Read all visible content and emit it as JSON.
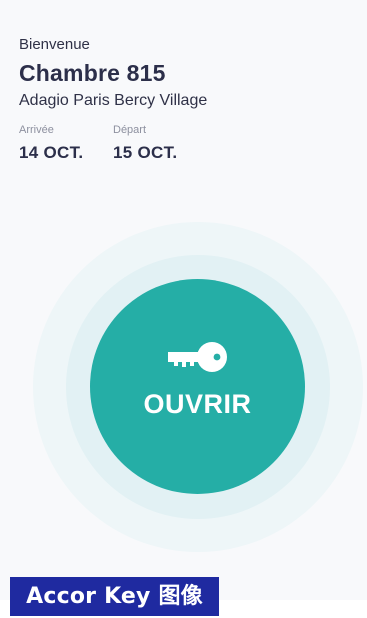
{
  "header": {
    "welcome": "Bienvenue",
    "room": "Chambre 815",
    "hotel": "Adagio Paris Bercy Village"
  },
  "stay": {
    "arrival_label": "Arrivée",
    "arrival_date": "14 OCT.",
    "departure_label": "Départ",
    "departure_date": "15 OCT."
  },
  "action": {
    "open_label": "OUVRIR",
    "icon": "key-icon"
  },
  "watermark": {
    "text": "Accor Key 图像"
  },
  "colors": {
    "accent": "#25aea6",
    "halo_outer": "#eef6f8",
    "halo_mid": "#e2f1f4",
    "text_dark": "#2c2f4a",
    "text_muted": "#8d909f",
    "watermark_bg": "#1f2aa0"
  }
}
